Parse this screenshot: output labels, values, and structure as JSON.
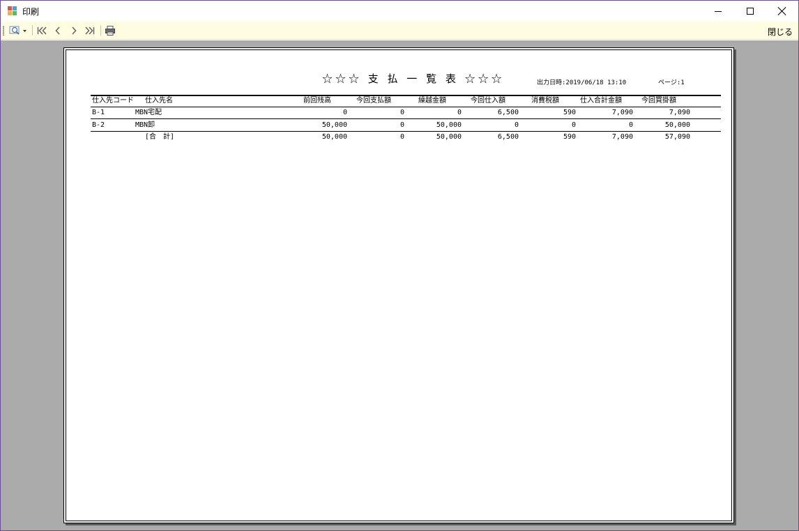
{
  "window": {
    "title": "印刷"
  },
  "toolbar": {
    "zoom_icon": "magnifier-icon",
    "first_icon": "first-page-icon",
    "prev_icon": "previous-page-icon",
    "next_icon": "next-page-icon",
    "last_icon": "last-page-icon",
    "print_icon": "printer-icon",
    "close_label": "閉じる"
  },
  "report": {
    "title": "☆☆☆ 支 払 一 覧 表 ☆☆☆",
    "output_datetime": "出力日時:2019/06/18 13:10",
    "page": "ページ:1",
    "headers": {
      "code": "仕入先コード",
      "name": "仕入先名",
      "prev_balance": "前回残高",
      "this_payment": "今回支払額",
      "carryover": "繰越金額",
      "this_purchase": "今回仕入額",
      "tax": "消費税額",
      "purchase_total": "仕入合計金額",
      "this_payable": "今回買掛額"
    },
    "rows": [
      {
        "code": "B-1",
        "name": "MBN宅配",
        "prev_balance": "0",
        "this_payment": "0",
        "carryover": "0",
        "this_purchase": "6,500",
        "tax": "590",
        "purchase_total": "7,090",
        "this_payable": "7,090"
      },
      {
        "code": "B-2",
        "name": "MBN卸",
        "prev_balance": "50,000",
        "this_payment": "0",
        "carryover": "50,000",
        "this_purchase": "0",
        "tax": "0",
        "purchase_total": "0",
        "this_payable": "50,000"
      }
    ],
    "total": {
      "label": "[合　計]",
      "prev_balance": "50,000",
      "this_payment": "0",
      "carryover": "50,000",
      "this_purchase": "6,500",
      "tax": "590",
      "purchase_total": "7,090",
      "this_payable": "57,090"
    }
  }
}
